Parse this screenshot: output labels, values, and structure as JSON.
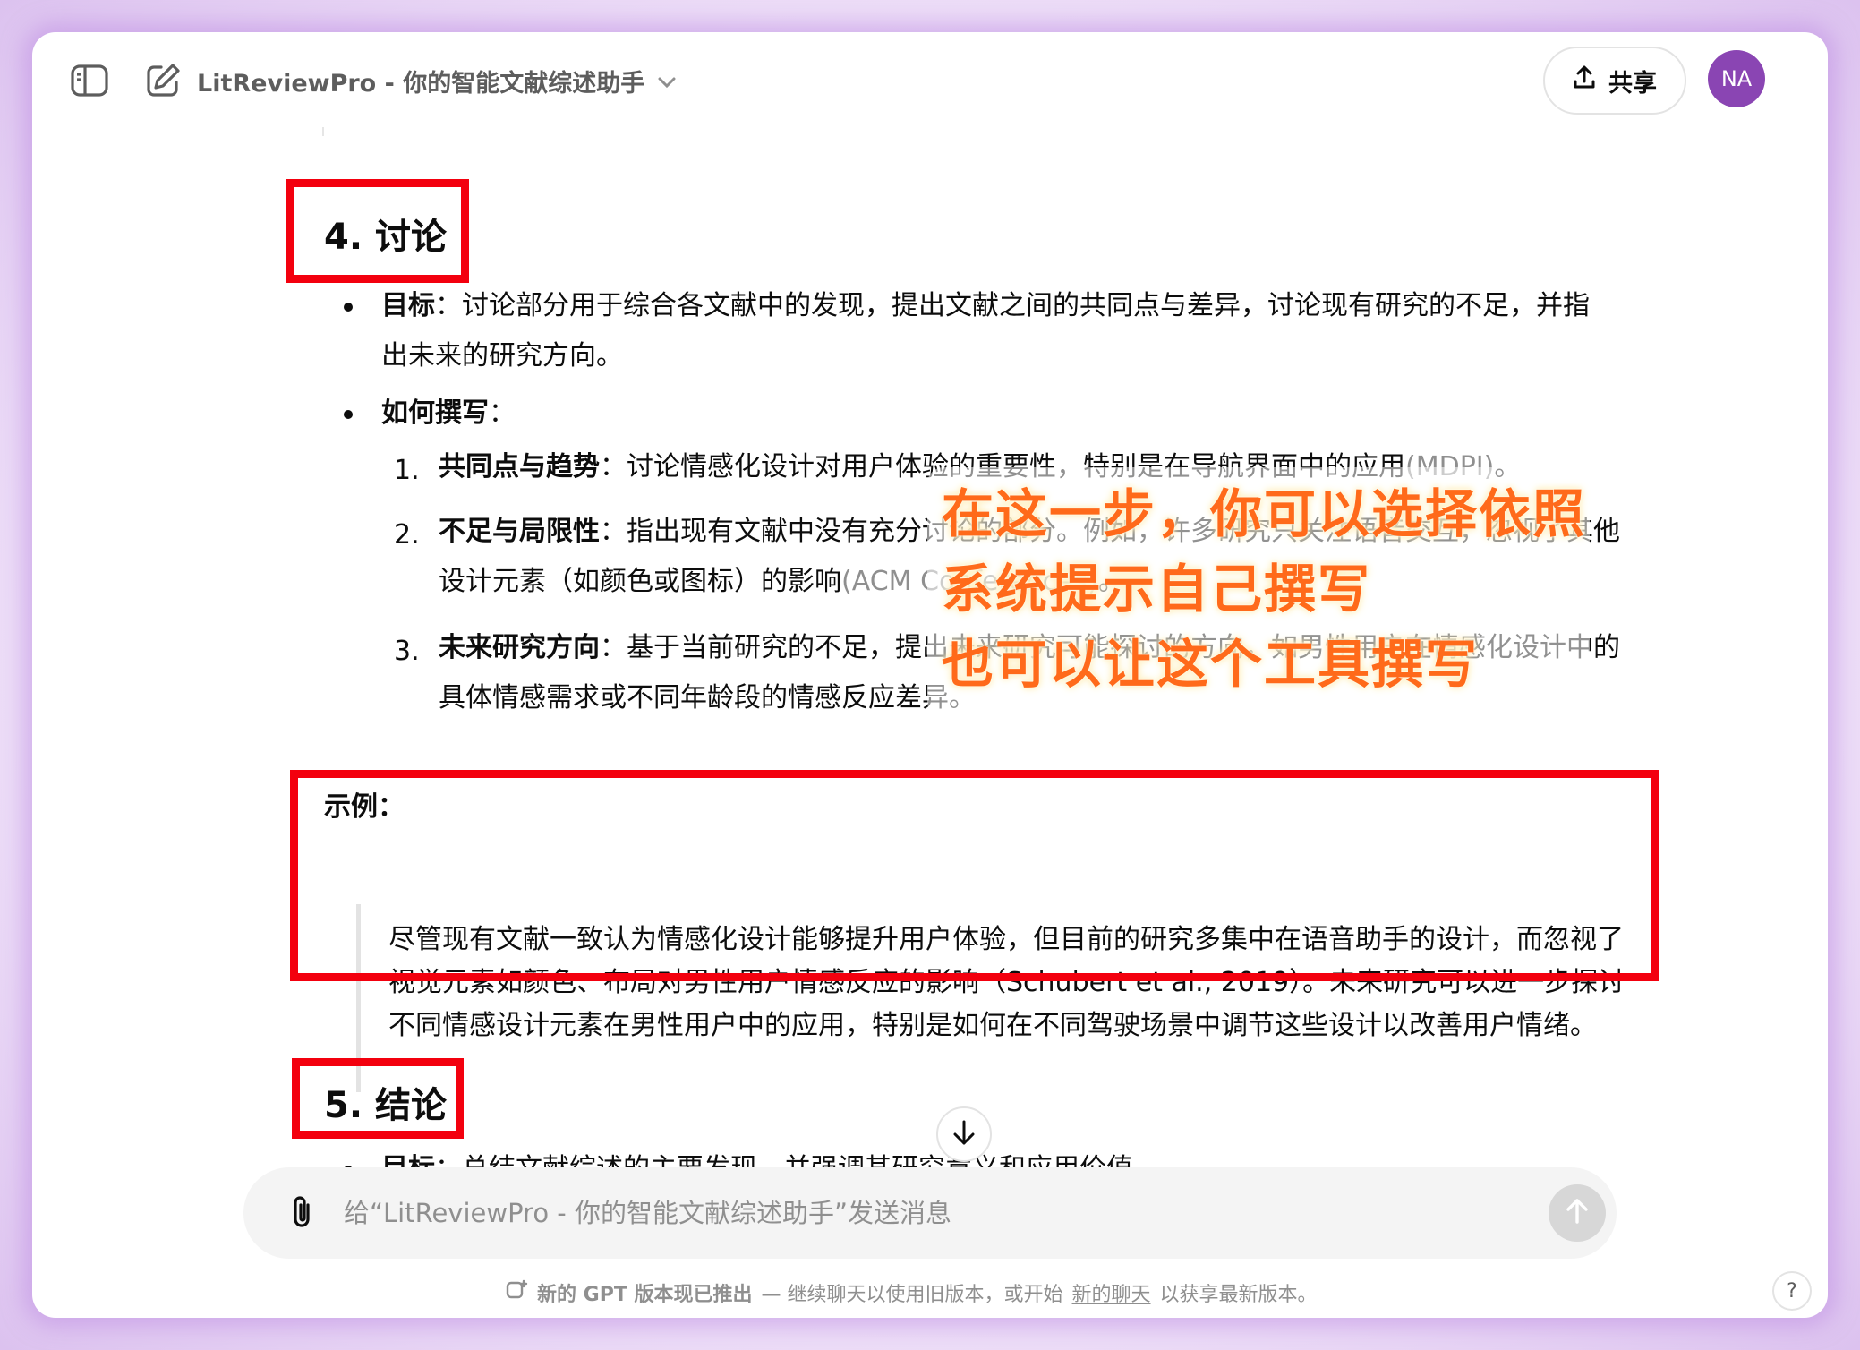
{
  "header": {
    "title": "LitReviewPro - 你的智能文献综述助手",
    "share_label": "共享",
    "avatar_initials": "NA",
    "avatar_color": "#8a45b3"
  },
  "section4": {
    "heading": "4. 讨论",
    "goal_label": "目标",
    "goal_text": "：讨论部分用于综合各文献中的发现，提出文献之间的共同点与差异，讨论现有研究的不足，并指出未来的研究方向。",
    "how_label": "如何撰写",
    "how_colon": "：",
    "items": [
      {
        "number": "1.",
        "label": "共同点与趋势",
        "text": "：讨论情感化设计对用户体验的重要性，特别是在导航界面中的应用",
        "source": "(MDPI)",
        "tail": "。"
      },
      {
        "number": "2.",
        "label": "不足与局限性",
        "text": "：指出现有文献中没有充分讨论的部分。例如，许多研究只关注语音交互，忽视了其他设计元素（如颜色或图标）的影响",
        "source": "(ACM Conferences)",
        "tail": "。"
      },
      {
        "number": "3.",
        "label": "未来研究方向",
        "text": "：基于当前研究的不足，提出未来研究可能探讨的方向，如男性用户在情感化设计中的具体情感需求或不同年龄段的情感反应差异。",
        "source": "",
        "tail": ""
      }
    ]
  },
  "example": {
    "label": "示例：",
    "quote": "尽管现有文献一致认为情感化设计能够提升用户体验，但目前的研究多集中在语音助手的设计，而忽视了视觉元素如颜色、布局对男性用户情感反应的影响（Schubert et al., 2019）。未来研究可以进一步探讨不同情感设计元素在男性用户中的应用，特别是如何在不同驾驶场景中调节这些设计以改善用户情绪。"
  },
  "section5": {
    "heading": "5. 结论",
    "goal_label": "目标",
    "goal_text": "：总结文献综述的主要发现，并强调其研究意义和应用价值。"
  },
  "annotation": {
    "line1": "在这一步，你可以选择依照",
    "line2": "系统提示自己撰写",
    "line3": "也可以让这个工具撰写",
    "color": "#ff6a1a"
  },
  "highlight_color": "#f3000e",
  "composer": {
    "placeholder": "给“LitReviewPro - 你的智能文献综述助手”发送消息"
  },
  "footer": {
    "strong": "新的 GPT 版本现已推出",
    "text": " — 继续聊天以使用旧版本，或开始",
    "link": "新的聊天",
    "text2": "以获享最新版本。",
    "help": "?"
  }
}
